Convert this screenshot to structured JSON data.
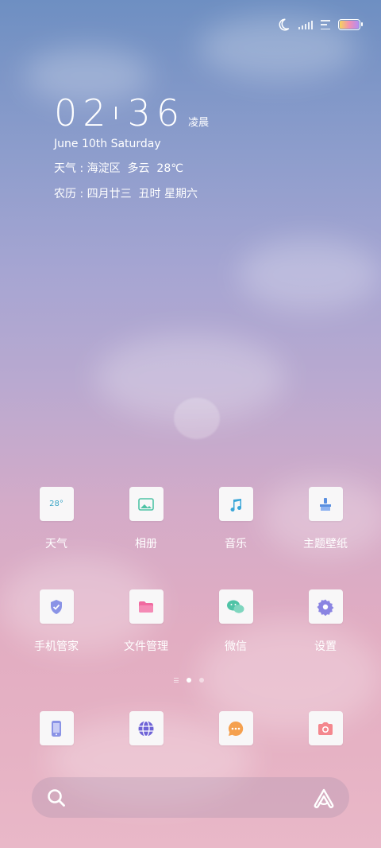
{
  "status_bar": {
    "icons": [
      "moon-icon",
      "signal-icon",
      "wifi-icon",
      "battery-icon"
    ],
    "battery_colors": [
      "#f4d35e",
      "#f28fb2",
      "#b38ef2"
    ]
  },
  "clock": {
    "hours": "02",
    "minutes": "36",
    "period": "凌晨",
    "date": "June 10th Saturday",
    "weather": "天气 : 海淀区  多云  28℃",
    "lunar": "农历 : 四月廿三  丑时 星期六"
  },
  "apps": [
    {
      "label": "天气",
      "icon": "weather-icon",
      "badge": "28°"
    },
    {
      "label": "相册",
      "icon": "gallery-icon"
    },
    {
      "label": "音乐",
      "icon": "music-icon"
    },
    {
      "label": "主题壁纸",
      "icon": "themes-icon"
    },
    {
      "label": "手机管家",
      "icon": "security-icon"
    },
    {
      "label": "文件管理",
      "icon": "files-icon"
    },
    {
      "label": "微信",
      "icon": "wechat-icon"
    },
    {
      "label": "设置",
      "icon": "settings-icon"
    }
  ],
  "dock": [
    {
      "icon": "phone-icon"
    },
    {
      "icon": "browser-icon"
    },
    {
      "icon": "messages-icon"
    },
    {
      "icon": "camera-icon"
    }
  ],
  "pages": {
    "count": 2,
    "current": 1
  },
  "search": {
    "left_icon": "search-icon",
    "right_icon": "assistant-icon"
  }
}
